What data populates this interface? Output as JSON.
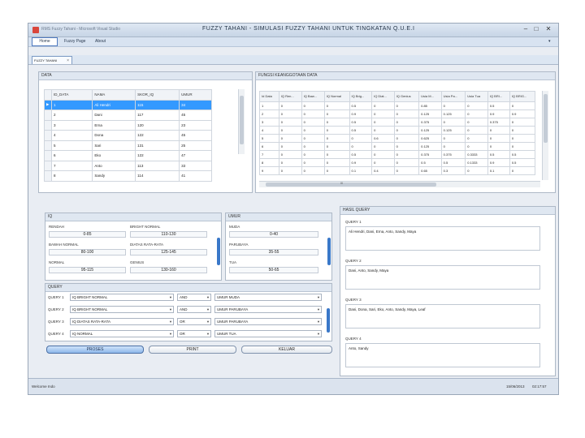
{
  "window": {
    "app_title": "RMS Fuzzy Tahani - Microsoft Visual Studio",
    "title": "FUZZY TAHANI - SIMULASI FUZZY TAHANI UNTUK TINGKATAN Q.U.E.I",
    "min_glyph": "–",
    "max_glyph": "□",
    "close_glyph": "✕",
    "expand_glyph": "▾"
  },
  "menu": {
    "items": [
      "Home",
      "Fuzzy Page",
      "About"
    ]
  },
  "tab": {
    "label": "FUZZY TAHANI",
    "close_glyph": "×"
  },
  "data_panel": {
    "title": "DATA",
    "columns": [
      "ID_DATA",
      "NAMA",
      "SKOR_IQ",
      "UMUR"
    ],
    "rows": [
      [
        "1",
        "Ali Hendri",
        "115",
        "34"
      ],
      [
        "2",
        "Dani",
        "117",
        "45"
      ],
      [
        "3",
        "Erna",
        "120",
        "23"
      ],
      [
        "4",
        "Dona",
        "122",
        "45"
      ],
      [
        "5",
        "Sari",
        "131",
        "25"
      ],
      [
        "6",
        "Eko",
        "122",
        "47"
      ],
      [
        "7",
        "Anto",
        "113",
        "33"
      ],
      [
        "8",
        "Sandy",
        "114",
        "41"
      ]
    ]
  },
  "membership_panel": {
    "title": "FUNGSI KEANGGOTAAN DATA",
    "columns": [
      "Id Data",
      "IQ Ren...",
      "IQ Baw...",
      "IQ Normal",
      "IQ Brig...",
      "IQ Diat...",
      "IQ Genius",
      "Usia M...",
      "Usia Pa...",
      "Usia Tua",
      "IQ BRI...",
      "IQ BRIG..."
    ],
    "rows": [
      [
        "1",
        "0",
        "0",
        "0",
        "0.5",
        "0",
        "0",
        "0.85",
        "0",
        "0",
        "0.5",
        "0"
      ],
      [
        "2",
        "0",
        "0",
        "0",
        "0.9",
        "0",
        "0",
        "0.125",
        "0.125",
        "0",
        "0.9",
        "0.9"
      ],
      [
        "3",
        "0",
        "0",
        "0",
        "0.5",
        "0",
        "0",
        "0.375",
        "0",
        "0",
        "0.375",
        "0"
      ],
      [
        "4",
        "0",
        "0",
        "0",
        "0.5",
        "0",
        "0",
        "0.125",
        "0.125",
        "0",
        "0",
        "0"
      ],
      [
        "5",
        "0",
        "0",
        "0",
        "0",
        "0.6",
        "0",
        "0.625",
        "0",
        "0",
        "0",
        "0"
      ],
      [
        "6",
        "0",
        "0",
        "0",
        "0",
        "0",
        "0",
        "0.125",
        "0",
        "0",
        "0",
        "0"
      ],
      [
        "7",
        "0",
        "0",
        "0",
        "0.5",
        "0",
        "0",
        "0.375",
        "0.375",
        "0.3333",
        "0.5",
        "0.5"
      ],
      [
        "8",
        "0",
        "0",
        "0",
        "0.9",
        "0",
        "0",
        "0.5",
        "0.5",
        "0.1333",
        "0.9",
        "0.5"
      ],
      [
        "9",
        "0",
        "0",
        "0",
        "0.1",
        "0.4",
        "0",
        "0.65",
        "0.3",
        "0",
        "0.1",
        "0"
      ]
    ],
    "scroll_marker": "III"
  },
  "iq_panel": {
    "title": "IQ",
    "fields": [
      {
        "label": "RENDAH",
        "value": "0-85"
      },
      {
        "label": "BRIGHT NORMAL",
        "value": "110-130"
      },
      {
        "label": "BAWAH NORMAL",
        "value": "80-100"
      },
      {
        "label": "DIATAS RATA-RATA",
        "value": "125-145"
      },
      {
        "label": "NORMAL",
        "value": "95-115"
      },
      {
        "label": "GENIUS",
        "value": "130-160"
      }
    ]
  },
  "umur_panel": {
    "title": "UMUR",
    "fields": [
      {
        "label": "MUDA",
        "value": "0-40"
      },
      {
        "label": "PARUBAYA",
        "value": "35-55"
      },
      {
        "label": "TUA",
        "value": "50-65"
      }
    ]
  },
  "query_panel": {
    "title": "QUERY",
    "rows": [
      {
        "label": "QUERY 1",
        "cond1": "IQ BRIGHT NORMAL",
        "op": "AND",
        "cond2": "UMUR MUDA"
      },
      {
        "label": "QUERY 2",
        "cond1": "IQ BRIGHT NORMAL",
        "op": "AND",
        "cond2": "UMUR PARUBAYA"
      },
      {
        "label": "QUERY 3",
        "cond1": "IQ DIATAS RATA-RATA",
        "op": "OR",
        "cond2": "UMUR PARUBAYA"
      },
      {
        "label": "QUERY 4",
        "cond1": "IQ NORMAL",
        "op": "OR",
        "cond2": "UMUR TUA"
      }
    ]
  },
  "buttons": {
    "process": "PROSES",
    "print": "PRINT",
    "exit": "KELUAR"
  },
  "results_panel": {
    "title": "HASIL QUERY",
    "items": [
      {
        "label": "QUERY 1",
        "text": "Ali Hendri, Dani, Erna, Anto, Sandy, Maya"
      },
      {
        "label": "QUERY 2",
        "text": "Dani, Anto, Sandy, Maya"
      },
      {
        "label": "QUERY 3",
        "text": "Dani, Dona, Sari, Eko, Anto, Sandy, Maya, Leaf"
      },
      {
        "label": "QUERY 4",
        "text": "Anto, Sandy"
      }
    ]
  },
  "status": {
    "welcome": "Welcome Indo",
    "date": "15/06/2013",
    "time": "02:17:57"
  }
}
